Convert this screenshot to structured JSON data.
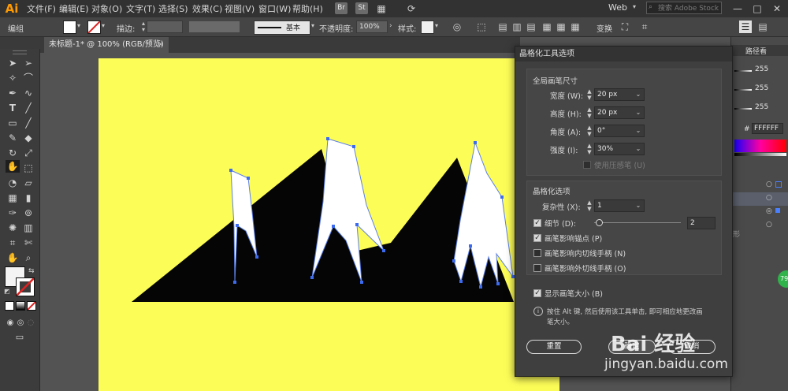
{
  "app": {
    "logo": "Ai"
  },
  "menu": [
    "文件(F)",
    "编辑(E)",
    "对象(O)",
    "文字(T)",
    "选择(S)",
    "效果(C)",
    "视图(V)",
    "窗口(W)",
    "帮助(H)"
  ],
  "menu_buttons": [
    "Br",
    "St"
  ],
  "workspace": "Web",
  "search": {
    "placeholder": "搜索 Adobe Stock"
  },
  "control": {
    "group_label": "编组",
    "stroke_label": "描边:",
    "stroke_style": "基本",
    "opacity_label": "不透明度:",
    "opacity_value": "100%",
    "style_label": "样式:",
    "transform_label": "变换"
  },
  "document_tab": "未标题-1* @ 100% (RGB/预览)",
  "right_panel": {
    "tab_label": "路径看",
    "color_values": [
      "255",
      "255",
      "255"
    ],
    "hex_prefix": "#",
    "hex_value": "FFFFFF",
    "partial_label": "形",
    "badge": "79"
  },
  "dialog": {
    "title": "晶格化工具选项",
    "global_brush": {
      "heading": "全局画笔尺寸",
      "width_label": "宽度 (W):",
      "width_value": "20 px",
      "height_label": "高度 (H):",
      "height_value": "20 px",
      "angle_label": "角度 (A):",
      "angle_value": "0°",
      "intensity_label": "强度 (I):",
      "intensity_value": "30%",
      "pressure_label": "使用压感笔 (U)"
    },
    "crystallize": {
      "heading": "晶格化选项",
      "complexity_label": "复杂性 (X):",
      "complexity_value": "1",
      "detail_label": "细节 (D):",
      "detail_value": "2",
      "detail_fraction": 0.05,
      "anchor_label": "画笔影响锚点 (P)",
      "in_tangent_label": "画笔影响内切线手柄 (N)",
      "out_tangent_label": "画笔影响外切线手柄 (O)"
    },
    "show_brush_label": "显示画笔大小 (B)",
    "info_text_1": "按住 Alt 键, 然后使用该工具单击, 即可相应地更改画",
    "info_text_2": "笔大小。",
    "reset_label": "重置",
    "ok_label": "确定",
    "cancel_label": "取消"
  },
  "watermark": {
    "brand": "Bai 经验",
    "url": "jingyan.baidu.com"
  },
  "colors": {
    "artboard": "#fdfd58",
    "accent": "#4a7fff",
    "ai_orange": "#ff9a00"
  }
}
